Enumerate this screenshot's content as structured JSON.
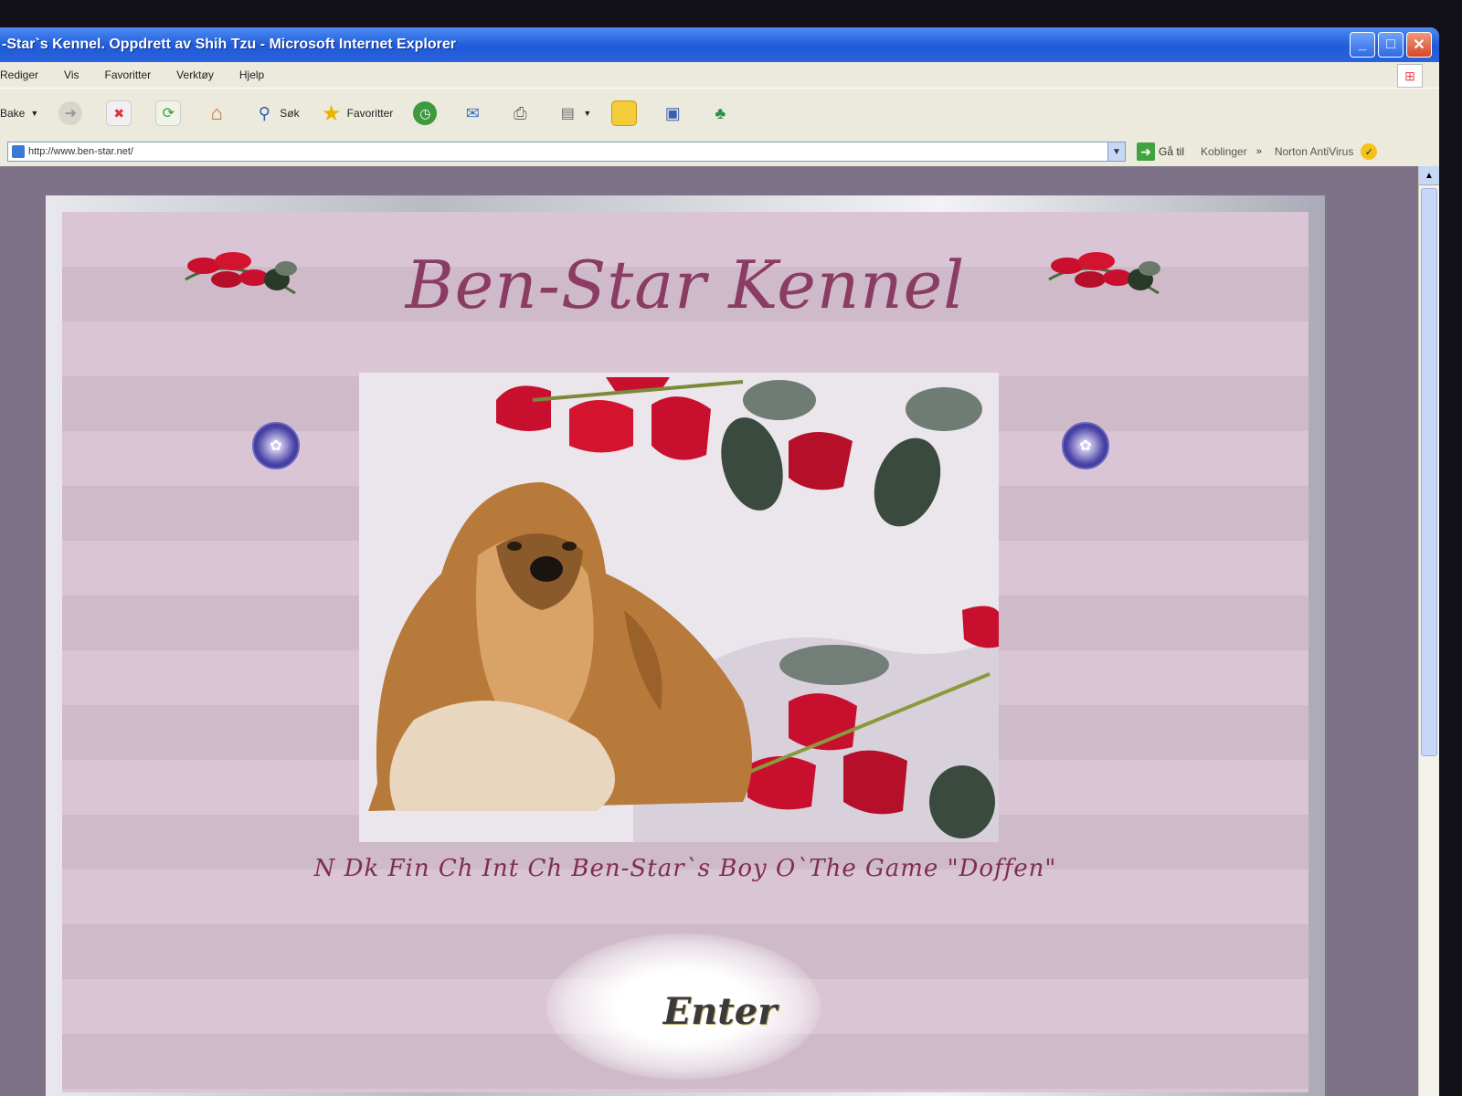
{
  "window": {
    "title": "-Star`s Kennel. Oppdrett av Shih Tzu - Microsoft Internet Explorer",
    "minimize": "_",
    "maximize": "□",
    "close": "✕"
  },
  "menu": {
    "items": [
      "Rediger",
      "Vis",
      "Favoritter",
      "Verktøy",
      "Hjelp"
    ]
  },
  "toolbar": {
    "back_label": "Bake",
    "search_label": "Søk",
    "favorites_label": "Favoritter"
  },
  "address": {
    "url": "http://www.ben-star.net/",
    "go_label": "Gå til",
    "links_label": "Koblinger",
    "norton_label": "Norton AntiVirus"
  },
  "page": {
    "title": "Ben-Star Kennel",
    "caption": "N Dk Fin Ch Int Ch Ben-Star`s Boy O`The Game \"Doffen\"",
    "enter_label": "Enter"
  },
  "colors": {
    "title_color": "#8a3c62",
    "panel_bg": "#d6c0cf",
    "page_bg": "#7e7288",
    "titlebar_blue": "#1f5ad8"
  },
  "icons": [
    "back-icon",
    "forward-icon",
    "stop-icon",
    "refresh-icon",
    "home-icon",
    "search-icon",
    "favorites-star-icon",
    "history-icon",
    "mail-icon",
    "print-icon",
    "edit-icon",
    "folder-icon",
    "media-icon",
    "messenger-icon"
  ]
}
